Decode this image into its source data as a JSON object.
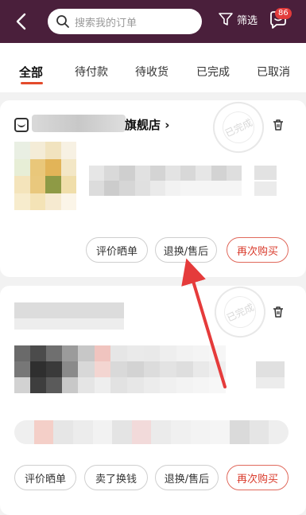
{
  "header": {
    "search_placeholder": "搜索我的订单",
    "filter_label": "筛选",
    "message_badge": "86"
  },
  "tabs": [
    {
      "label": "全部",
      "active": true
    },
    {
      "label": "待付款",
      "active": false
    },
    {
      "label": "待收货",
      "active": false
    },
    {
      "label": "已完成",
      "active": false
    },
    {
      "label": "已取消",
      "active": false
    }
  ],
  "orders": [
    {
      "store_name": "旗舰店",
      "status_stamp": "已完成",
      "actions": [
        "评价晒单",
        "退换/售后",
        "再次购买"
      ]
    },
    {
      "status_stamp": "已完成",
      "actions": [
        "评价晒单",
        "卖了换钱",
        "退换/售后",
        "再次购买"
      ]
    }
  ],
  "colors": {
    "header_bg": "#4a1f3b",
    "accent_red": "#d93a2b",
    "tab_underline": "#e34b2c",
    "arrow": "#e53b3b"
  }
}
